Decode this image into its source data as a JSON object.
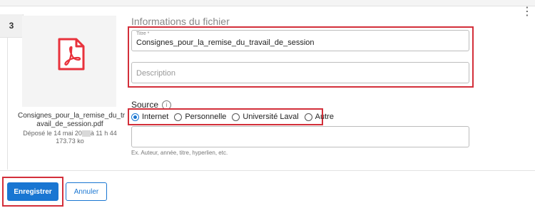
{
  "card": {
    "number": "3"
  },
  "file": {
    "name": "Consignes_pour_la_remise_du_travail_de_session.pdf",
    "name_line1": "Consignes_pour_la_remise_du_tr",
    "name_line2": "avail_de_session.pdf",
    "deposit_prefix": "Déposé le 14 mai 20",
    "deposit_suffix": "à 11 h 44",
    "size": "173.73 ko"
  },
  "form": {
    "section_title": "Informations du fichier",
    "title_label": "Titre *",
    "title_value": "Consignes_pour_la_remise_du_travail_de_session",
    "description_placeholder": "Description",
    "source_label": "Source",
    "source_options": [
      "Internet",
      "Personnelle",
      "Université Laval",
      "Autre"
    ],
    "source_selected": "Internet",
    "source_details_value": "",
    "helper_text": "Ex. Auteur, année, titre, hyperlien, etc."
  },
  "actions": {
    "save_label": "Enregistrer",
    "cancel_label": "Annuler"
  },
  "colors": {
    "accent": "#1976d2",
    "highlight": "#d32f3a",
    "pdf_icon": "#e8323c"
  },
  "icons": {
    "menu": "kebab-menu-icon",
    "file": "pdf-file-icon",
    "info": "info-icon"
  }
}
